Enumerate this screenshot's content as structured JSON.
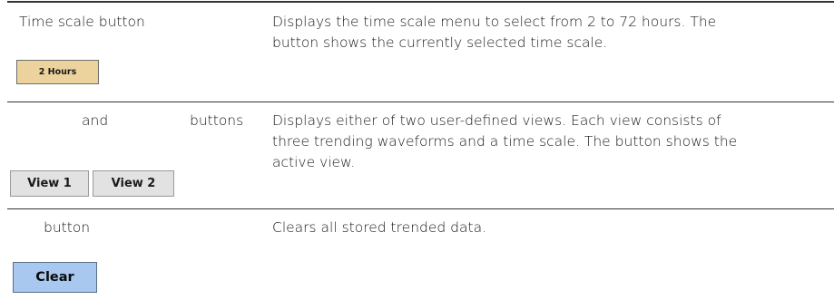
{
  "rows": [
    {
      "label": "Time scale button",
      "button_label": "2 Hours",
      "description": [
        "Displays the time scale menu to select from 2 to 72 hours. The",
        "button shows the currently selected time scale."
      ]
    },
    {
      "label_and": "and",
      "label_buttons": "buttons",
      "button_labels": [
        "View 1",
        "View 2"
      ],
      "description": [
        "Displays either of two user-defined views. Each view consists of",
        "three trending waveforms and a time scale. The button shows the",
        "active view."
      ]
    },
    {
      "label": "button",
      "button_label": "Clear",
      "description": [
        "Clears all stored trended data."
      ]
    }
  ],
  "colors": {
    "time_button_bg": "#ecd29c",
    "view_button_bg": "#e2e2e2",
    "clear_button_bg": "#a9c8f0",
    "rule": "#333333"
  }
}
